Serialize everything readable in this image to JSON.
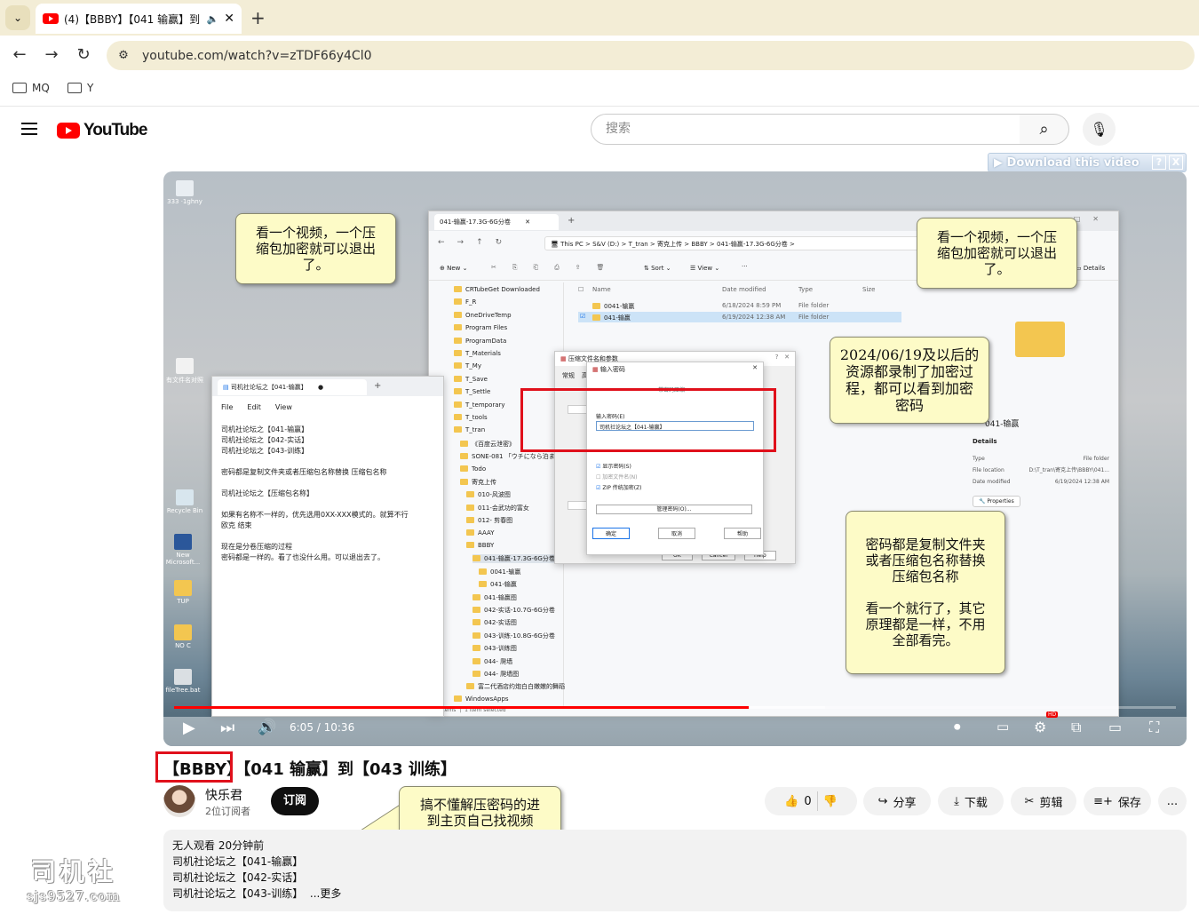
{
  "browser": {
    "tab_title": "(4)【BBBY】【041 输赢】到【",
    "url": "youtube.com/watch?v=zTDF66y4Cl0",
    "bookmarks": [
      "MQ",
      "Y"
    ]
  },
  "youtube": {
    "logo_text": "YouTube",
    "search_placeholder": "搜索",
    "download_bar_label": "Download this video",
    "download_bar_help": "?",
    "download_bar_close": "X"
  },
  "player": {
    "time_display": "6:05 / 10:36",
    "progress_fraction": 0.574,
    "buffered_fraction": 0.65,
    "hd_badge": "HD"
  },
  "video_content": {
    "explorer": {
      "tab": "041-输赢-17.3G-6G分卷",
      "breadcrumb": [
        "This PC",
        "S&V (D:)",
        "T_tran",
        "寄克上传",
        "BBBY",
        "041-输赢-17.3G-6G分卷"
      ],
      "new_btn": "New",
      "sort_btn": "Sort",
      "view_btn": "View",
      "details_btn": "Details",
      "columns": [
        "Name",
        "Date modified",
        "Type",
        "Size"
      ],
      "rows": [
        {
          "name": "0041-输赢",
          "date": "6/18/2024 8:59 PM",
          "type": "File folder"
        },
        {
          "name": "041-输赢",
          "date": "6/19/2024 12:38 AM",
          "type": "File folder"
        }
      ],
      "tree": [
        "CRTubeGet Downloaded",
        "F_R",
        "OneDriveTemp",
        "Program Files",
        "ProgramData",
        "T_Materials",
        "T_My",
        "T_Save",
        "T_Settle",
        "T_temporary",
        "T_tools",
        "T_tran",
        "《百度云泄密》",
        "SONE-081 「ウチになら泊ま",
        "Todo",
        "寄克上传",
        "010-风波图",
        "011-会武功的富女",
        "012- 剪春图",
        "AAAY",
        "BBBY",
        "041-输赢-17.3G-6G分卷",
        "0041-输赢",
        "041-输赢",
        "041-输赢图",
        "042-实话-10.7G-6G分卷",
        "042-实话图",
        "043-训练-10.8G-6G分卷",
        "043-训练图",
        "044- 爬墙",
        "044- 爬墙图",
        "富二代酒店约炮白白嫩嫩的舞蹈",
        "WindowsApps"
      ],
      "status": [
        "2 items",
        "1 item selected"
      ],
      "detail_name": "041-输赢",
      "detail_header": "Details",
      "detail_rows": [
        [
          "Type",
          "File folder"
        ],
        [
          "File location",
          "D:\\T_tran\\寄克上传\\BBBY\\041..."
        ],
        [
          "Date modified",
          "6/19/2024 12:38 AM"
        ]
      ],
      "properties_btn": "Properties"
    },
    "notepad": {
      "tab": "司机社论坛之【041-输赢】",
      "menu": [
        "File",
        "Edit",
        "View"
      ],
      "lines": [
        "司机社论坛之【041-输赢】",
        "司机社论坛之【042-实话】",
        "司机社论坛之【043-训练】",
        "",
        "密码都是复制文件夹或者压缩包名称替换 压缩包名称",
        "",
        "司机社论坛之【压缩包名称】",
        "",
        "如果有名称不一样的，优先选用0XX-XXX模式的。就算不行",
        "欧克 结束",
        "",
        "现在是分卷压缩的过程",
        "密码都是一样的。看了也没什么用。可以退出去了。"
      ]
    },
    "dialog_params": {
      "title": "压缩文件名和参数",
      "tabs": [
        "常规",
        "高"
      ],
      "buttons": [
        "OK",
        "Cancel",
        "Help"
      ]
    },
    "dialog_password": {
      "title": "输入密码",
      "header": "带密码压缩",
      "label": "输入密码(E)",
      "value": "司机社论坛之【041-输赢】",
      "options": [
        "显示密码(S)",
        "加密文件名(N)",
        "ZIP 传统加密(Z)"
      ],
      "manage_btn": "管理密码(O)...",
      "buttons": [
        "确定",
        "取消",
        "帮助"
      ]
    },
    "desktop_icons": [
      "Recycle Bin",
      "New Microsoft...",
      "TUP",
      "NO C",
      "fileTree.bat"
    ]
  },
  "notes": {
    "note1": "看一个视频，一个压\n缩包加密就可以退出\n了。",
    "note2": "看一个视频，一个压\n缩包加密就可以退出\n了。",
    "note3": "2024/06/19及以后的\n资源都录制了加密过\n程，都可以看到加密\n密码",
    "note4": "密码都是复制文件夹\n或者压缩包名称替换\n压缩包名称\n\n看一个就行了，其它\n原理都是一样，不用\n全部看完。",
    "note5": "搞不懂解压密码的进\n到主页自己找视频"
  },
  "video": {
    "title": "【BBBY】【041 输赢】到【043 训练】",
    "channel": "快乐君",
    "subscribers": "2位订阅者",
    "subscribe_label": "订阅",
    "likes": "0",
    "share_label": "分享",
    "download_label": "下载",
    "clip_label": "剪辑",
    "save_label": "保存",
    "more_label": "..."
  },
  "description": {
    "meta": "无人观看  20分钟前",
    "lines": [
      "司机社论坛之【041-输赢】",
      "司机社论坛之【042-实话】",
      "司机社论坛之【043-训练】"
    ],
    "more": "...更多"
  },
  "watermark": {
    "line1": "司机社",
    "line2": "sjs9527.com"
  },
  "colors": {
    "accent_red": "#ff0000",
    "annotation_red": "#e0101b",
    "note_bg": "#fdfbc7",
    "chrome_bg": "#f3edd6"
  }
}
